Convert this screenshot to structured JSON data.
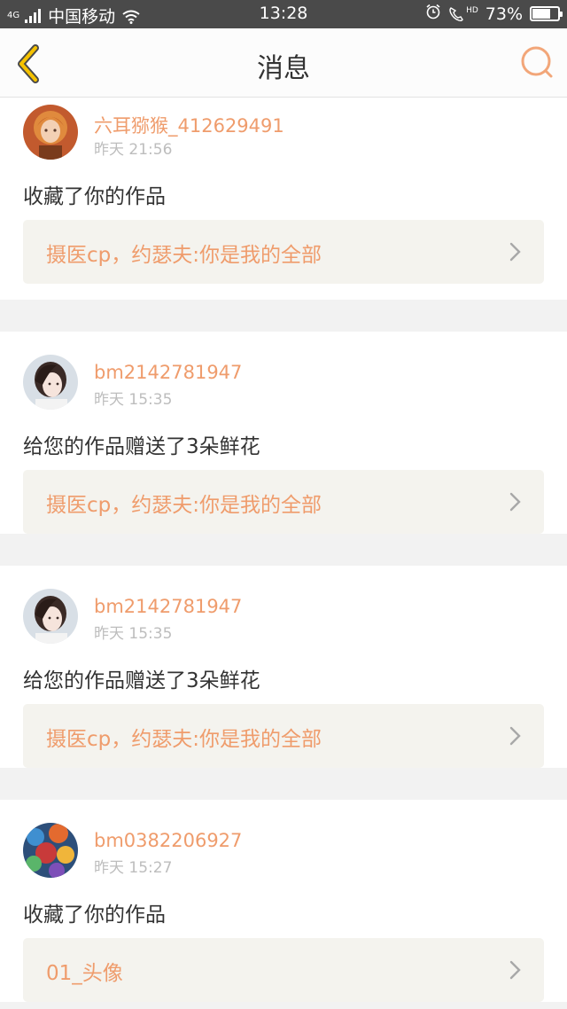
{
  "status_bar": {
    "network": "4G",
    "carrier": "中国移动",
    "time": "13:28",
    "hd": "HD",
    "battery_percent": "73%",
    "battery_level": 0.73
  },
  "header": {
    "title": "消息",
    "back_icon": "chevron-left-icon",
    "search_icon": "search-icon",
    "accent_color": "#f5c200",
    "search_color": "#f2a679"
  },
  "messages": [
    {
      "username": "六耳猕猴_412629491",
      "time": "昨天 21:56",
      "action": "收藏了你的作品",
      "work_title": "摄医cp，约瑟夫:你是我的全部"
    },
    {
      "username": "bm2142781947",
      "time": "昨天 15:35",
      "action": "给您的作品赠送了3朵鲜花",
      "work_title": "摄医cp，约瑟夫:你是我的全部"
    },
    {
      "username": "bm2142781947",
      "time": "昨天 15:35",
      "action": "给您的作品赠送了3朵鲜花",
      "work_title": "摄医cp，约瑟夫:你是我的全部"
    },
    {
      "username": "bm0382206927",
      "time": "昨天 15:27",
      "action": "收藏了你的作品",
      "work_title": "01_头像"
    }
  ]
}
